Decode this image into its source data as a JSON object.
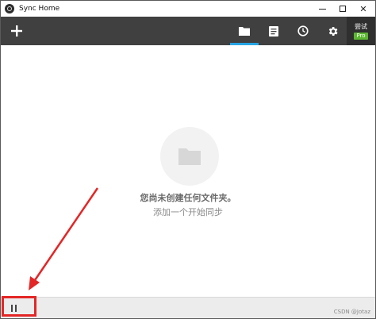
{
  "window": {
    "title": "Sync Home",
    "controls": {
      "minimize": "minimize",
      "maximize": "maximize",
      "close": "✕"
    }
  },
  "toolbar": {
    "add_icon": "plus-icon",
    "tabs": [
      {
        "name": "folders",
        "icon": "folder-icon",
        "active": true
      },
      {
        "name": "history",
        "icon": "document-icon",
        "active": false
      },
      {
        "name": "clock",
        "icon": "clock-icon",
        "active": false
      },
      {
        "name": "settings",
        "icon": "gear-icon",
        "active": false
      }
    ],
    "trial_label": "尝试",
    "pro_badge": "Pro"
  },
  "empty_state": {
    "icon": "folder-icon",
    "message": "您尚未创建任何文件夹。",
    "action_link": "添加一个开始同步"
  },
  "statusbar": {
    "pause_icon": "pause-icon",
    "watermark": "CSDN @Jotaz"
  },
  "colors": {
    "toolbar_bg": "#404040",
    "accent": "#27a5e4",
    "pro_badge": "#5bb731",
    "annotation": "#e32626"
  }
}
